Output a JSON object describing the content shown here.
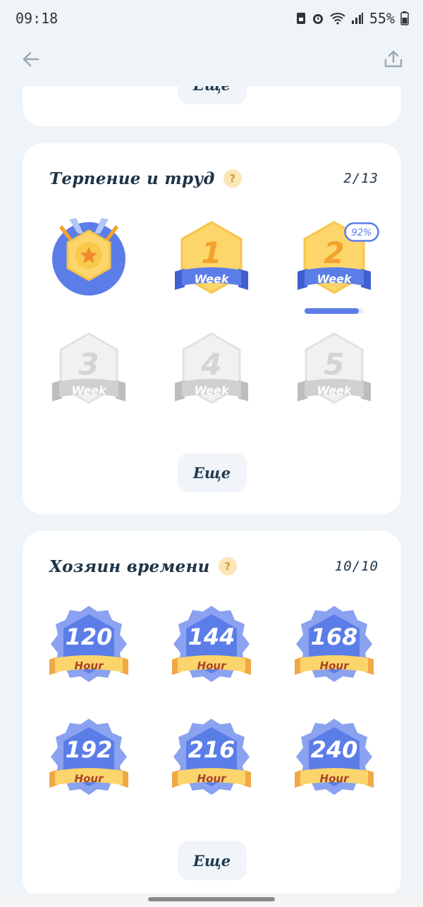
{
  "status_bar": {
    "time": "09:18",
    "battery": "55%"
  },
  "more_label": "Еще",
  "section_patience": {
    "title": "Терпение и труд",
    "help": "?",
    "count": "2/13",
    "badges": [
      {
        "kind": "medal",
        "earned": true
      },
      {
        "kind": "week",
        "number": "1",
        "label": "Week",
        "earned": true
      },
      {
        "kind": "week",
        "number": "2",
        "label": "Week",
        "earned": true,
        "percent": "92%",
        "progress": 0.92
      },
      {
        "kind": "week",
        "number": "3",
        "label": "Week",
        "earned": false
      },
      {
        "kind": "week",
        "number": "4",
        "label": "Week",
        "earned": false
      },
      {
        "kind": "week",
        "number": "5",
        "label": "Week",
        "earned": false
      }
    ]
  },
  "section_time": {
    "title": "Хозяин времени",
    "help": "?",
    "count": "10/10",
    "badges": [
      {
        "number": "120",
        "label": "Hour"
      },
      {
        "number": "144",
        "label": "Hour"
      },
      {
        "number": "168",
        "label": "Hour"
      },
      {
        "number": "192",
        "label": "Hour"
      },
      {
        "number": "216",
        "label": "Hour"
      },
      {
        "number": "240",
        "label": "Hour"
      }
    ]
  },
  "colors": {
    "background": "#eef4f8",
    "accent_blue": "#5b7de8",
    "gold": "#fcd66a",
    "ribbon_yellow": "#fbd56b",
    "number_orange": "#f4a12d",
    "locked_gray": "#d4d4d4"
  }
}
